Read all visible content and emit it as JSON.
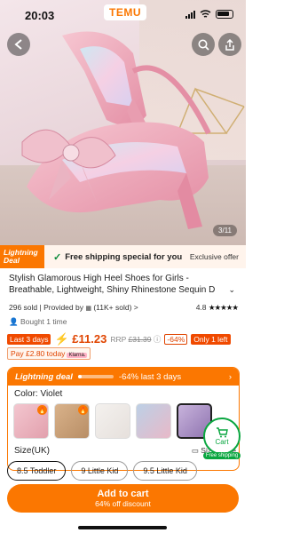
{
  "status": {
    "time": "20:03",
    "brand": "TEMU"
  },
  "hero": {
    "pager": "3/11"
  },
  "deal_bar": {
    "badge_line1": "Lightning",
    "badge_line2": "Deal",
    "shipping": "Free shipping special for you",
    "exclusive": "Exclusive offer"
  },
  "product": {
    "title_line1": "Stylish Glamorous High Heel Shoes for Girls -",
    "title_line2": "Breathable, Lightweight, Shiny Rhinestone Sequin D",
    "sold": "296 sold",
    "provided_by": "Provided by",
    "provided_by_rest": "(11K+ sold) >",
    "rating": "4.8",
    "stars": "★★★★★",
    "bought": "Bought 1 time"
  },
  "price": {
    "last_days": "Last 3 days",
    "amount": "£11.23",
    "rrp_label": "RRP",
    "rrp_value": "£31.39",
    "info": "ⓘ",
    "discount": "-64%",
    "stock": "Only 1 left",
    "pay_later": "Pay £2.80 today",
    "pay_later_brand": "Klarna."
  },
  "flash": {
    "label": "Lightning deal",
    "progress": 0.1,
    "message": "-64% last 3 days",
    "color_label": "Color: Violet",
    "size_label": "Size(UK)",
    "size_guide": "Size guide"
  },
  "swatches": [
    {
      "name": "pink-sequin",
      "colors": [
        "#f3c6cf",
        "#e2a0ad"
      ],
      "hot": true
    },
    {
      "name": "gold",
      "colors": [
        "#d9b28a",
        "#b88e66"
      ],
      "hot": true
    },
    {
      "name": "white",
      "colors": [
        "#f4f1ee",
        "#e6e0dc"
      ],
      "hot": false
    },
    {
      "name": "blue-pink",
      "colors": [
        "#bcd0e6",
        "#e8b9c8"
      ],
      "hot": false
    },
    {
      "name": "violet",
      "colors": [
        "#c8b3dc",
        "#8f74b0"
      ],
      "hot": false
    }
  ],
  "cart_float": {
    "label": "Cart",
    "ship": "Free shipping"
  },
  "sizes": [
    "8.5 Toddler",
    "9 Little Kid",
    "9.5 Little Kid"
  ],
  "add_cart": {
    "label": "Add to cart",
    "sub": "64% off discount"
  }
}
